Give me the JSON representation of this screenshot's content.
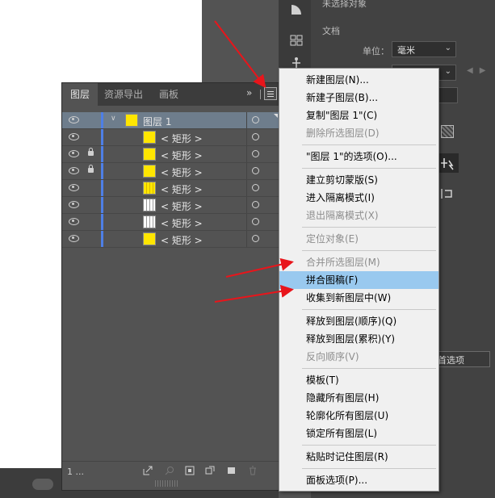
{
  "canvas": {},
  "properties_panel": {
    "title": "未选择对象",
    "document_label": "文档",
    "unit_label": "单位：",
    "unit_value": "毫米",
    "preferences_button": "首选项"
  },
  "layers_panel": {
    "tabs": [
      {
        "label": "图层",
        "active": true
      },
      {
        "label": "资源导出",
        "active": false
      },
      {
        "label": "画板",
        "active": false
      }
    ],
    "collapse_glyph": "»",
    "rows": [
      {
        "name": "图层 1",
        "thumbnail": "yellow",
        "visible": true,
        "locked": false,
        "selected": true,
        "expanded": true
      },
      {
        "name": "< 矩形 >",
        "thumbnail": "yellow",
        "visible": true,
        "locked": false
      },
      {
        "name": "< 矩形 >",
        "thumbnail": "yellow",
        "visible": true,
        "locked": true
      },
      {
        "name": "< 矩形 >",
        "thumbnail": "yellow",
        "visible": true,
        "locked": true
      },
      {
        "name": "< 矩形 >",
        "thumbnail": "yellow-lines",
        "visible": true,
        "locked": false
      },
      {
        "name": "< 矩形 >",
        "thumbnail": "white-lines",
        "visible": true,
        "locked": false
      },
      {
        "name": "< 矩形 >",
        "thumbnail": "white-lines",
        "visible": true,
        "locked": false
      },
      {
        "name": "< 矩形 >",
        "thumbnail": "yellow",
        "visible": true,
        "locked": false
      }
    ],
    "layer_color": "#4e7fe6",
    "footer_count": "1 ..."
  },
  "context_menu": {
    "items": [
      {
        "label": "新建图层(N)...",
        "disabled": false
      },
      {
        "label": "新建子图层(B)...",
        "disabled": false
      },
      {
        "label": "复制\"图层 1\"(C)",
        "disabled": false
      },
      {
        "label": "删除所选图层(D)",
        "disabled": true
      },
      {
        "separator": true
      },
      {
        "label": "\"图层 1\"的选项(O)...",
        "disabled": false
      },
      {
        "separator": true
      },
      {
        "label": "建立剪切蒙版(S)",
        "disabled": false
      },
      {
        "label": "进入隔离模式(I)",
        "disabled": false
      },
      {
        "label": "退出隔离模式(X)",
        "disabled": true
      },
      {
        "separator": true
      },
      {
        "label": "定位对象(E)",
        "disabled": true
      },
      {
        "separator": true
      },
      {
        "label": "合并所选图层(M)",
        "disabled": true
      },
      {
        "label": "拼合图稿(F)",
        "disabled": false,
        "highlighted": true
      },
      {
        "label": "收集到新图层中(W)",
        "disabled": false
      },
      {
        "separator": true
      },
      {
        "label": "释放到图层(顺序)(Q)",
        "disabled": false
      },
      {
        "label": "释放到图层(累积)(Y)",
        "disabled": false
      },
      {
        "label": "反向顺序(V)",
        "disabled": true
      },
      {
        "separator": true
      },
      {
        "label": "模板(T)",
        "disabled": false
      },
      {
        "label": "隐藏所有图层(H)",
        "disabled": false
      },
      {
        "label": "轮廓化所有图层(U)",
        "disabled": false
      },
      {
        "label": "锁定所有图层(L)",
        "disabled": false
      },
      {
        "separator": true
      },
      {
        "label": "粘贴时记住图层(R)",
        "disabled": false
      },
      {
        "separator": true
      },
      {
        "label": "面板选项(P)...",
        "disabled": false
      }
    ],
    "highlight_color": "#99c9ef"
  },
  "annotations": {
    "arrow_color": "#e8151b"
  }
}
